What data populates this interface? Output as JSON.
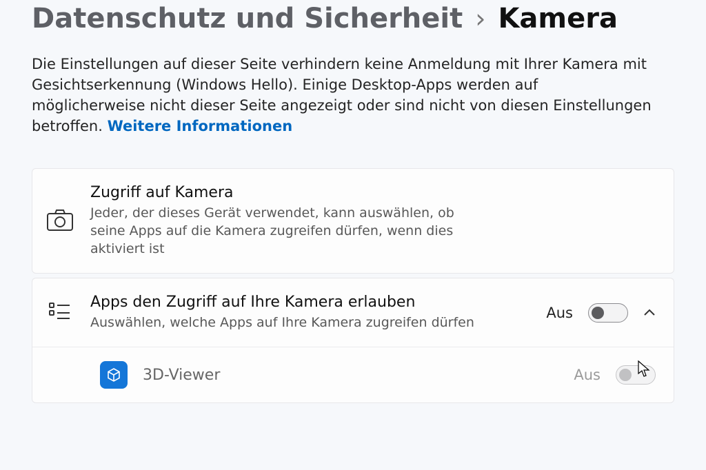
{
  "breadcrumb": {
    "parent": "Datenschutz und Sicherheit",
    "separator": "›",
    "current": "Kamera"
  },
  "intro": {
    "text": "Die Einstellungen auf dieser Seite verhindern keine Anmeldung mit Ihrer Kamera mit Gesichtserkennung (Windows Hello). Einige Desktop-Apps werden auf möglicherweise nicht dieser Seite angezeigt oder sind nicht von diesen Einstellungen betroffen. ",
    "link": "Weitere Informationen"
  },
  "items": {
    "camera_access": {
      "title": "Zugriff auf Kamera",
      "desc": "Jeder, der dieses Gerät verwendet, kann auswählen, ob seine Apps auf die Kamera zugreifen dürfen, wenn dies aktiviert ist"
    },
    "app_access": {
      "title": "Apps den Zugriff auf Ihre Kamera erlauben",
      "desc": "Auswählen, welche Apps auf Ihre Kamera zugreifen dürfen",
      "state_label": "Aus",
      "expanded": true,
      "apps": [
        {
          "name": "3D-Viewer",
          "state_label": "Aus",
          "icon_color": "#1476d8"
        }
      ]
    }
  }
}
